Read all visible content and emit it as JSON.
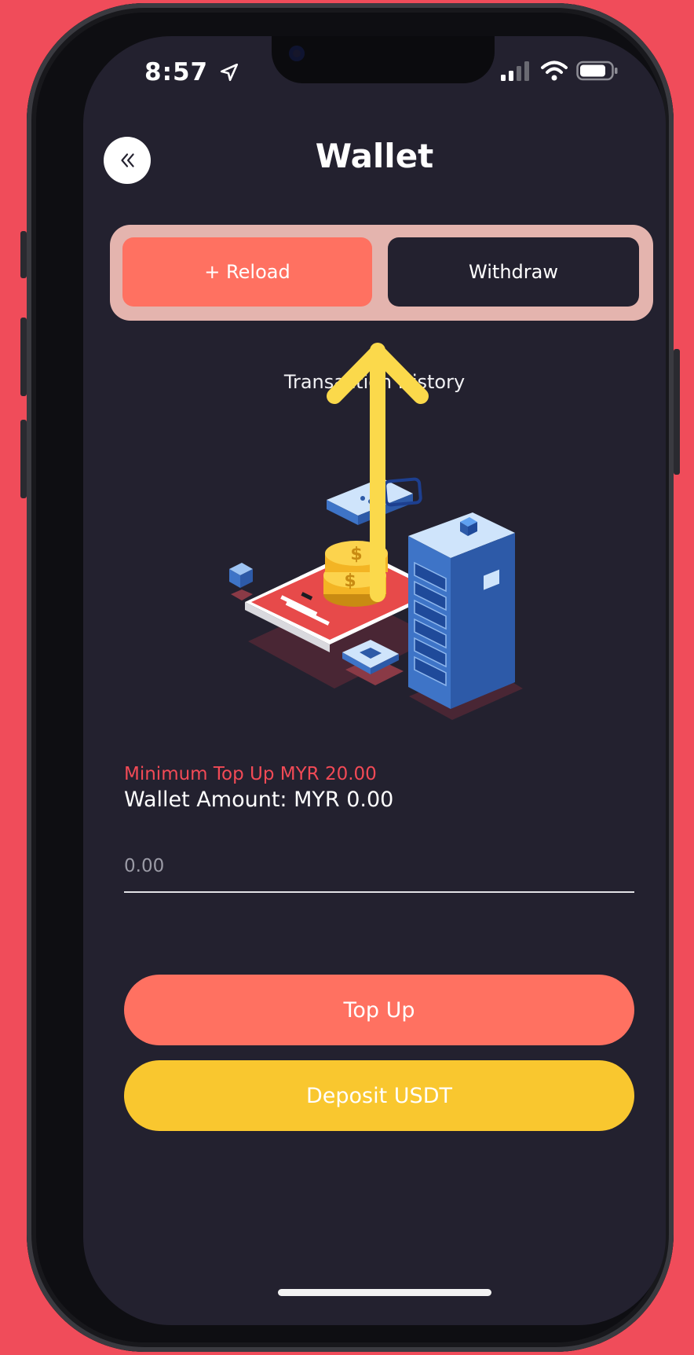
{
  "status": {
    "time": "8:57"
  },
  "header": {
    "title": "Wallet"
  },
  "tabs": {
    "reload": "+ Reload",
    "withdraw": "Withdraw"
  },
  "history_link": "Transaction History",
  "illustration": {
    "phone_mark": "$",
    "coin_mark": "$"
  },
  "topup": {
    "minimum": "Minimum Top Up MYR 20.00",
    "wallet_amount": "Wallet Amount: MYR 0.00",
    "amount_placeholder": "0.00"
  },
  "buttons": {
    "top_up": "Top Up",
    "deposit_usdt": "Deposit USDT"
  },
  "colors": {
    "background": "#f04c5a",
    "screen": "#23212f",
    "accent": "#ff7161",
    "yellow": "#f9c72f",
    "error": "#f24a56",
    "arrow": "#fbd94b"
  }
}
